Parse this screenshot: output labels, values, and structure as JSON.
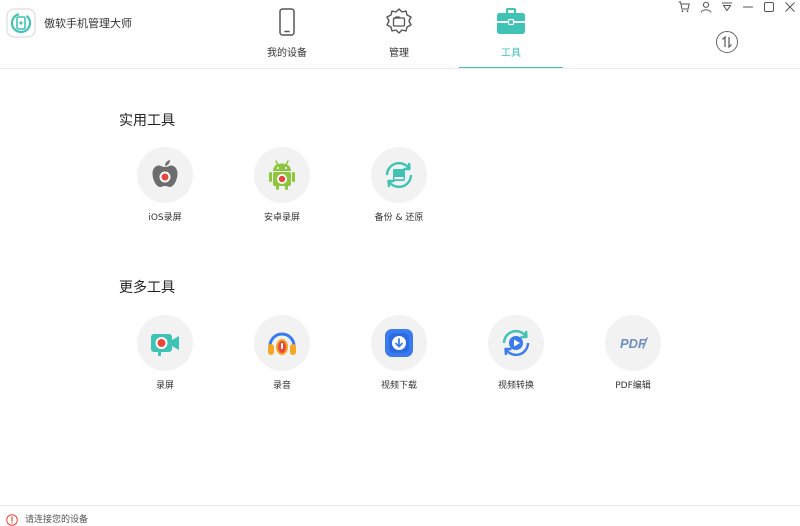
{
  "app": {
    "title": "傲软手机管理大师"
  },
  "nav": {
    "tabs": [
      {
        "label": "我的设备",
        "icon": "phone-icon"
      },
      {
        "label": "管理",
        "icon": "folder-gear-icon"
      },
      {
        "label": "工具",
        "icon": "toolbox-icon",
        "active": true
      }
    ]
  },
  "window_controls": [
    "cart-icon",
    "user-icon",
    "dropdown-icon",
    "minimize-icon",
    "maximize-icon",
    "close-icon"
  ],
  "sections": {
    "practical": {
      "title": "实用工具",
      "tools": [
        {
          "label": "iOS录屏",
          "icon": "apple-record-icon"
        },
        {
          "label": "安卓录屏",
          "icon": "android-record-icon"
        },
        {
          "label": "备份 & 还原",
          "icon": "backup-restore-icon"
        }
      ]
    },
    "more": {
      "title": "更多工具",
      "tools": [
        {
          "label": "录屏",
          "icon": "video-camera-icon"
        },
        {
          "label": "录音",
          "icon": "headphones-icon"
        },
        {
          "label": "视频下载",
          "icon": "video-download-icon"
        },
        {
          "label": "视频转换",
          "icon": "video-convert-icon"
        },
        {
          "label": "PDF编辑",
          "icon": "pdf-icon",
          "glyph": "PDF"
        }
      ]
    }
  },
  "status": {
    "text": "请连接您的设备"
  },
  "colors": {
    "accent": "#3fc3b4",
    "record_red": "#e8483c",
    "android_green": "#8cc63f",
    "blue": "#3a7cf0",
    "pdf_blue": "#6f8fbf"
  }
}
